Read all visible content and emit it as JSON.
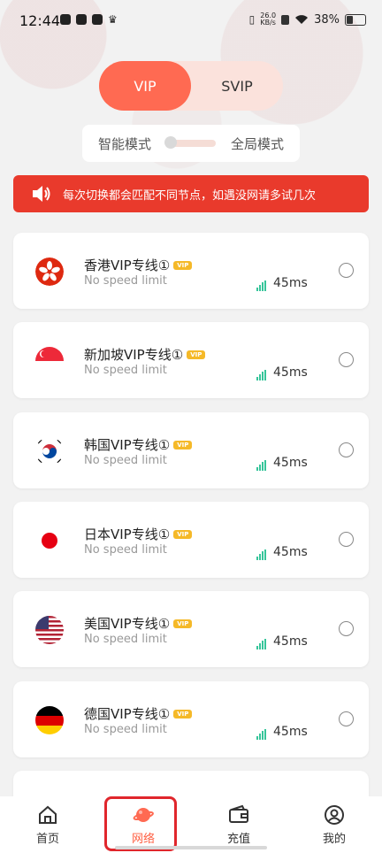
{
  "status": {
    "time": "12:44",
    "netspeed_value": "26.0",
    "netspeed_unit": "KB/s",
    "battery": "38%"
  },
  "tabs": [
    {
      "label": "VIP",
      "active": true
    },
    {
      "label": "SVIP",
      "active": false
    }
  ],
  "mode": {
    "left": "智能模式",
    "right": "全局模式"
  },
  "notice": "每次切换都会匹配不同节点，如遇没网请多试几次",
  "servers": [
    {
      "name": "香港VIP专线①",
      "badge": "VIP",
      "sub": "No speed limit",
      "ping": "45ms",
      "flag": "hk-flag"
    },
    {
      "name": "新加坡VIP专线①",
      "badge": "VIP",
      "sub": "No speed limit",
      "ping": "45ms",
      "flag": "sg-flag"
    },
    {
      "name": "韩国VIP专线①",
      "badge": "VIP",
      "sub": "No speed limit",
      "ping": "45ms",
      "flag": "kr-flag"
    },
    {
      "name": "日本VIP专线①",
      "badge": "VIP",
      "sub": "No speed limit",
      "ping": "45ms",
      "flag": "jp-flag"
    },
    {
      "name": "美国VIP专线①",
      "badge": "VIP",
      "sub": "No speed limit",
      "ping": "45ms",
      "flag": "us-flag"
    },
    {
      "name": "德国VIP专线①",
      "badge": "VIP",
      "sub": "No speed limit",
      "ping": "45ms",
      "flag": "de-flag"
    }
  ],
  "nav": [
    {
      "label": "首页",
      "icon": "home-icon"
    },
    {
      "label": "网络",
      "icon": "planet-icon",
      "active": true
    },
    {
      "label": "充值",
      "icon": "wallet-icon"
    },
    {
      "label": "我的",
      "icon": "user-icon"
    }
  ],
  "colors": {
    "accent": "#ff6a52",
    "notice": "#e93a2c",
    "signal": "#36c59a",
    "badge": "#f5b928"
  }
}
